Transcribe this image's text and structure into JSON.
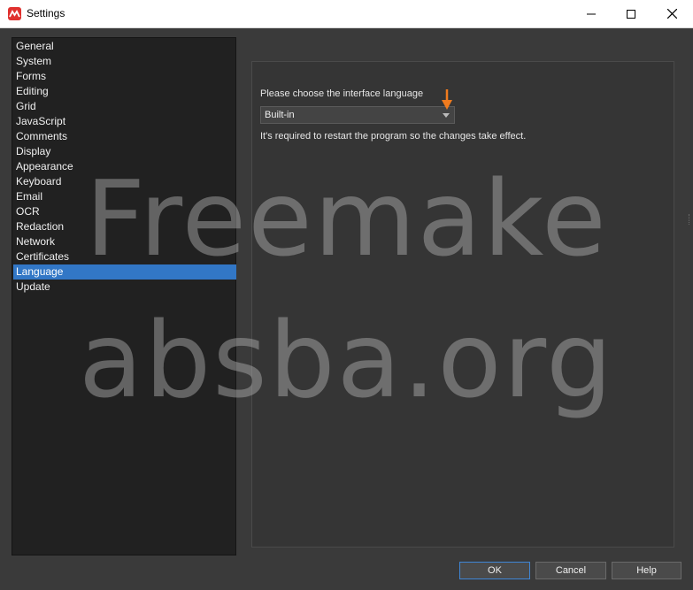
{
  "window": {
    "title": "Settings"
  },
  "titlebar_icons": {
    "app": "app-logo-icon",
    "minimize": "minimize-icon",
    "maximize": "maximize-icon",
    "close": "close-icon"
  },
  "sidebar": {
    "items": [
      {
        "label": "General"
      },
      {
        "label": "System"
      },
      {
        "label": "Forms"
      },
      {
        "label": "Editing"
      },
      {
        "label": "Grid"
      },
      {
        "label": "JavaScript"
      },
      {
        "label": "Comments"
      },
      {
        "label": "Display"
      },
      {
        "label": "Appearance"
      },
      {
        "label": "Keyboard"
      },
      {
        "label": "Email"
      },
      {
        "label": "OCR"
      },
      {
        "label": "Redaction"
      },
      {
        "label": "Network"
      },
      {
        "label": "Certificates"
      },
      {
        "label": "Language"
      },
      {
        "label": "Update"
      }
    ],
    "selected": "Language"
  },
  "language": {
    "prompt": "Please choose the interface language",
    "selected_value": "Built-in",
    "note": "It's required to restart the program so the changes take effect."
  },
  "watermark": {
    "line1": "Freemake",
    "line2": "absba.org"
  },
  "buttons": {
    "ok": "OK",
    "cancel": "Cancel",
    "help": "Help"
  },
  "colors": {
    "selection": "#3277c6",
    "accent_arrow": "#f07b1e",
    "brand": "#e0312e"
  }
}
